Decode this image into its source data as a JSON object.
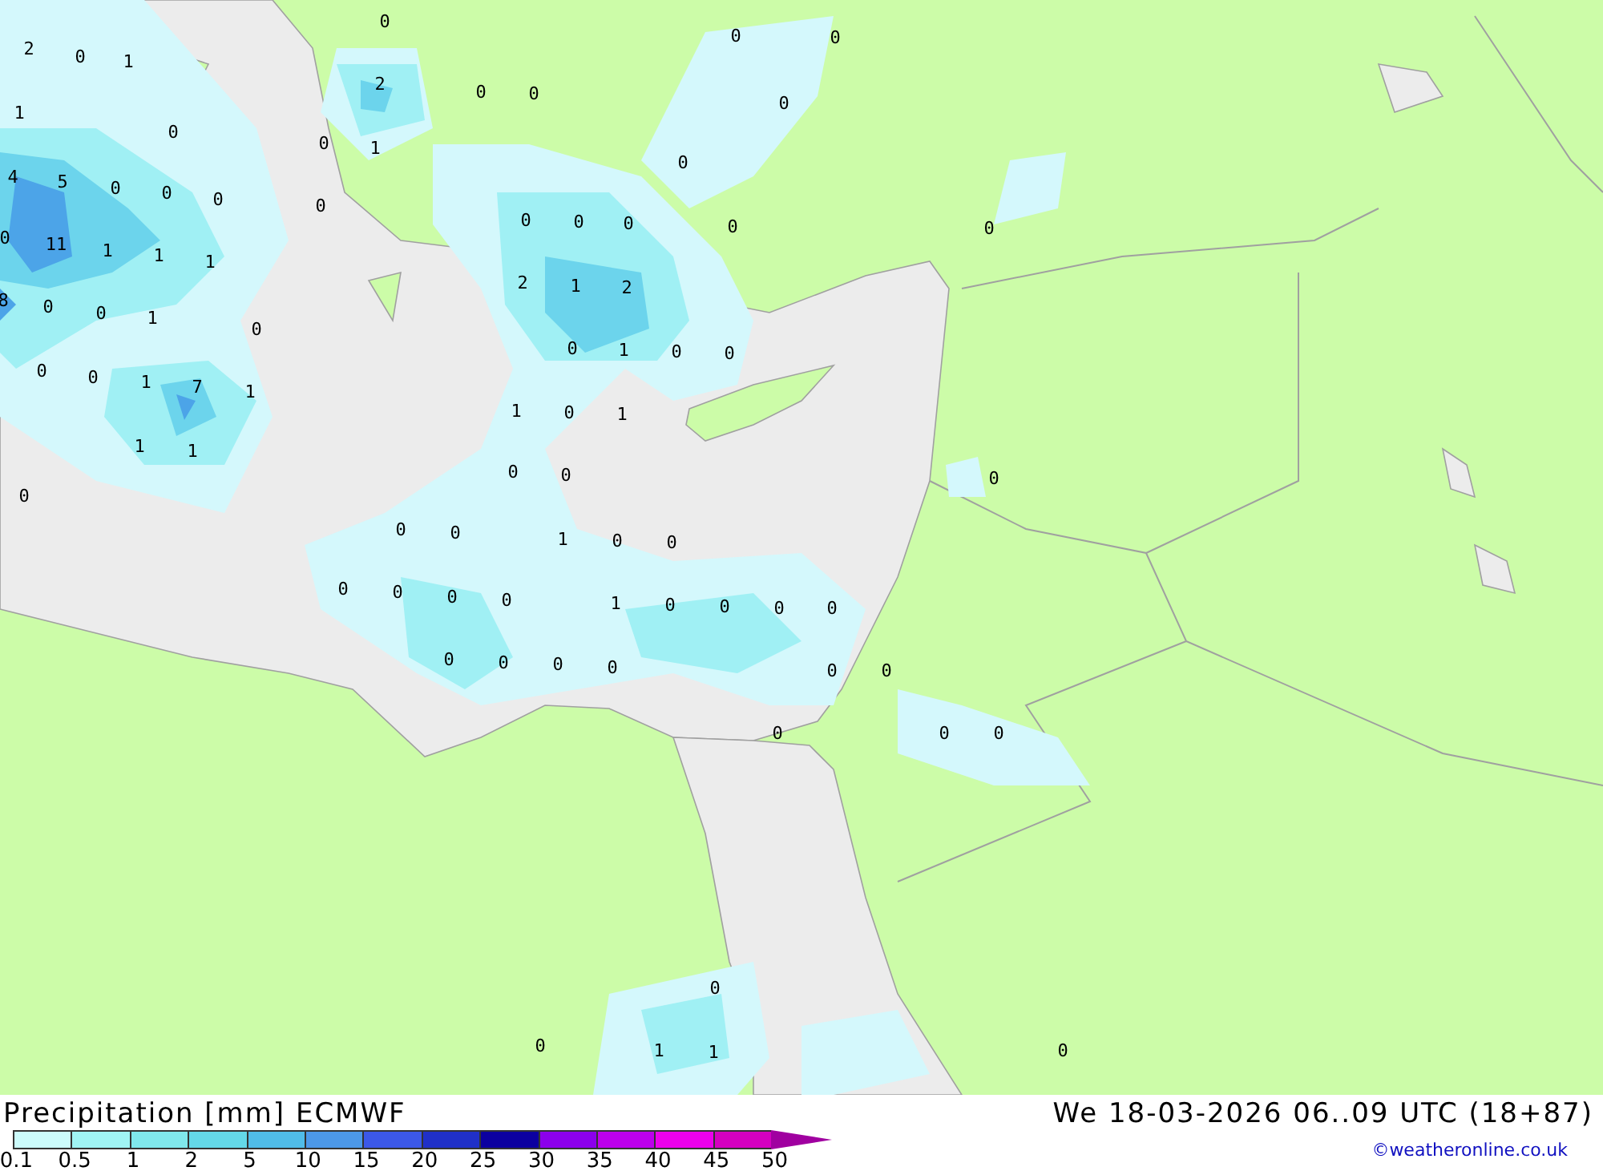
{
  "map_labels": [
    {
      "text": "0"
    },
    {
      "text": "2"
    },
    {
      "text": "0"
    },
    {
      "text": "1"
    },
    {
      "text": "0"
    },
    {
      "text": "0"
    },
    {
      "text": "2"
    },
    {
      "text": "0"
    },
    {
      "text": "0"
    },
    {
      "text": "0"
    },
    {
      "text": "1"
    },
    {
      "text": "0"
    },
    {
      "text": "0"
    },
    {
      "text": "1"
    },
    {
      "text": "0"
    },
    {
      "text": "4"
    },
    {
      "text": "5"
    },
    {
      "text": "0"
    },
    {
      "text": "0"
    },
    {
      "text": "0"
    },
    {
      "text": "0"
    },
    {
      "text": "0"
    },
    {
      "text": "0"
    },
    {
      "text": "0"
    },
    {
      "text": "0"
    },
    {
      "text": "0"
    },
    {
      "text": "0"
    },
    {
      "text": "11"
    },
    {
      "text": "1"
    },
    {
      "text": "1"
    },
    {
      "text": "1"
    },
    {
      "text": "2"
    },
    {
      "text": "1"
    },
    {
      "text": "2"
    },
    {
      "text": "8"
    },
    {
      "text": "0"
    },
    {
      "text": "0"
    },
    {
      "text": "1"
    },
    {
      "text": "0"
    },
    {
      "text": "0"
    },
    {
      "text": "1"
    },
    {
      "text": "0"
    },
    {
      "text": "0"
    },
    {
      "text": "0"
    },
    {
      "text": "0"
    },
    {
      "text": "1"
    },
    {
      "text": "7"
    },
    {
      "text": "1"
    },
    {
      "text": "1"
    },
    {
      "text": "0"
    },
    {
      "text": "1"
    },
    {
      "text": "1"
    },
    {
      "text": "1"
    },
    {
      "text": "0"
    },
    {
      "text": "0"
    },
    {
      "text": "0"
    },
    {
      "text": "0"
    },
    {
      "text": "0"
    },
    {
      "text": "0"
    },
    {
      "text": "1"
    },
    {
      "text": "0"
    },
    {
      "text": "0"
    },
    {
      "text": "0"
    },
    {
      "text": "0"
    },
    {
      "text": "0"
    },
    {
      "text": "0"
    },
    {
      "text": "1"
    },
    {
      "text": "0"
    },
    {
      "text": "0"
    },
    {
      "text": "0"
    },
    {
      "text": "0"
    },
    {
      "text": "0"
    },
    {
      "text": "0"
    },
    {
      "text": "0"
    },
    {
      "text": "0"
    },
    {
      "text": "0"
    },
    {
      "text": "0"
    },
    {
      "text": "0"
    },
    {
      "text": "0"
    },
    {
      "text": "0"
    },
    {
      "text": "0"
    },
    {
      "text": "0"
    },
    {
      "text": "1"
    },
    {
      "text": "1"
    },
    {
      "text": "0"
    }
  ],
  "title": "Precipitation [mm] ECMWF",
  "valid_time": "We 18-03-2026 06..09 UTC (18+87)",
  "legend": {
    "items": [
      {
        "color": "#ccfcfc"
      },
      {
        "color": "#a0f4f4"
      },
      {
        "color": "#80e8ec"
      },
      {
        "color": "#64d8e8"
      },
      {
        "color": "#50bce8"
      },
      {
        "color": "#4c98e8"
      },
      {
        "color": "#3c58e8"
      },
      {
        "color": "#2030c8"
      },
      {
        "color": "#0c00a0"
      },
      {
        "color": "#8c00ec"
      },
      {
        "color": "#bc00ec"
      },
      {
        "color": "#ec00ec"
      },
      {
        "color": "#d400c0"
      }
    ],
    "ticks": [
      "0.1",
      "0.5",
      "1",
      "2",
      "5",
      "10",
      "15",
      "20",
      "25",
      "30",
      "35",
      "40",
      "45",
      "50"
    ]
  },
  "credit": "©weatheronline.co.uk"
}
